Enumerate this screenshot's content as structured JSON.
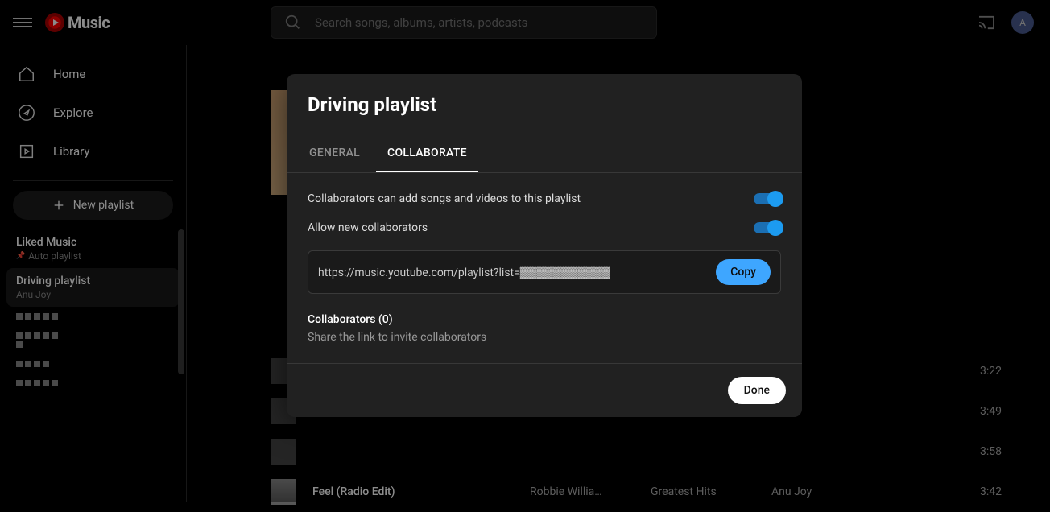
{
  "logo": "Music",
  "search_placeholder": "Search songs, albums, artists, podcasts",
  "avatar_initial": "A",
  "nav": {
    "home": "Home",
    "explore": "Explore",
    "library": "Library"
  },
  "new_playlist": "New playlist",
  "playlists": {
    "liked": {
      "title": "Liked Music",
      "sub": "Auto playlist"
    },
    "driving": {
      "title": "Driving playlist",
      "sub": "Anu Joy"
    }
  },
  "tracks": [
    {
      "title": "",
      "artist": "",
      "album": "",
      "added": "",
      "dur": "3:22"
    },
    {
      "title": "",
      "artist": "",
      "album": "",
      "added": "",
      "dur": "3:49"
    },
    {
      "title": "",
      "artist": "",
      "album": "",
      "added": "",
      "dur": "3:58"
    },
    {
      "title": "Feel (Radio Edit)",
      "artist": "Robbie Willia…",
      "album": "Greatest Hits",
      "added": "Anu Joy",
      "dur": "3:42"
    }
  ],
  "modal": {
    "title": "Driving playlist",
    "tab_general": "GENERAL",
    "tab_collab": "COLLABORATE",
    "row1": "Collaborators can add songs and videos to this playlist",
    "row2": "Allow new collaborators",
    "link": "https://music.youtube.com/playlist?list=▓▓▓▓▓▓▓▓▓▓▓",
    "copy": "Copy",
    "collab_head": "Collaborators (0)",
    "collab_sub": "Share the link to invite collaborators",
    "done": "Done"
  }
}
